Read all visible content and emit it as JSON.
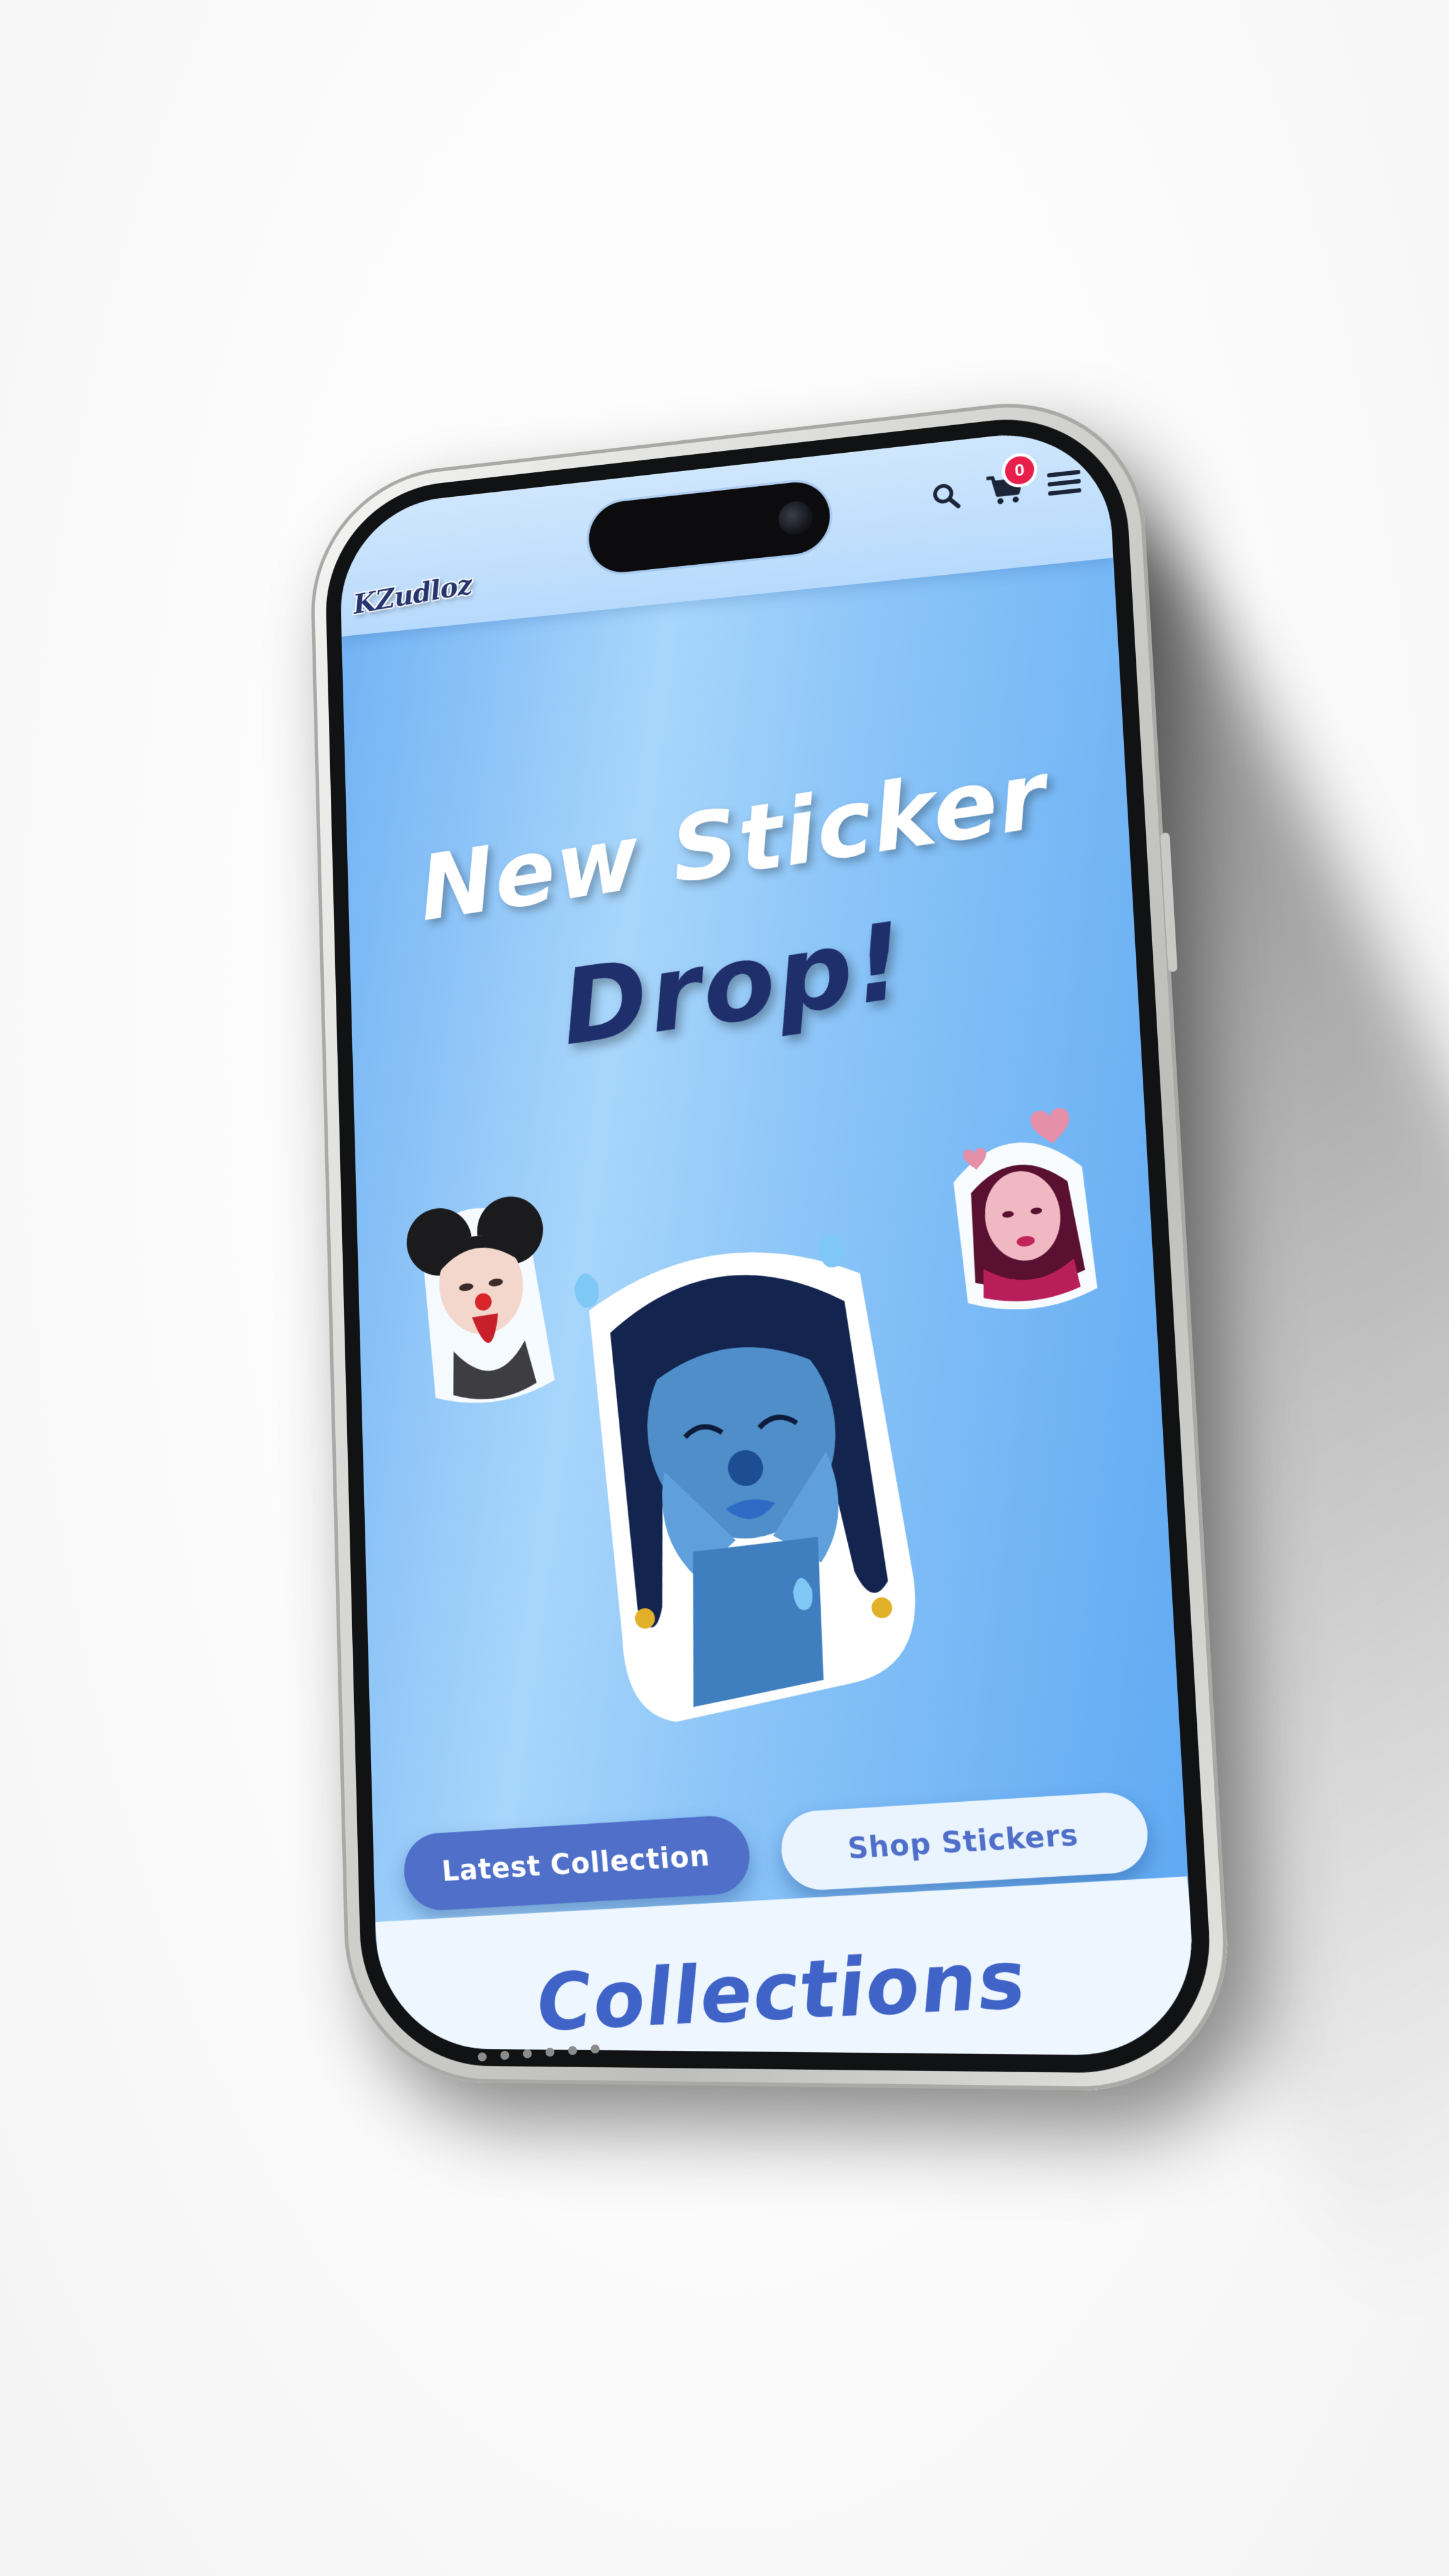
{
  "header": {
    "logo_text": "KZudloz",
    "cart_count": "0",
    "icons": [
      "search-icon",
      "cart-icon",
      "menu-icon"
    ]
  },
  "hero": {
    "title_line1": "New Sticker",
    "title_line2": "Drop!",
    "stickers": [
      "sticker-clown-girl-black-hair",
      "sticker-crying-blue-clown",
      "sticker-pink-clown-hearts"
    ]
  },
  "buttons": {
    "latest_collection": "Latest Collection",
    "shop_stickers": "Shop Stickers"
  },
  "collections": {
    "title": "Collections"
  },
  "colors": {
    "hero_blue": "#8cc5f8",
    "header_blue": "#cfe6fd",
    "primary_button": "#4f6fc9",
    "secondary_button": "#eaf4ff",
    "title_dark": "#1f2f6b",
    "badge_red": "#e81e4b"
  }
}
